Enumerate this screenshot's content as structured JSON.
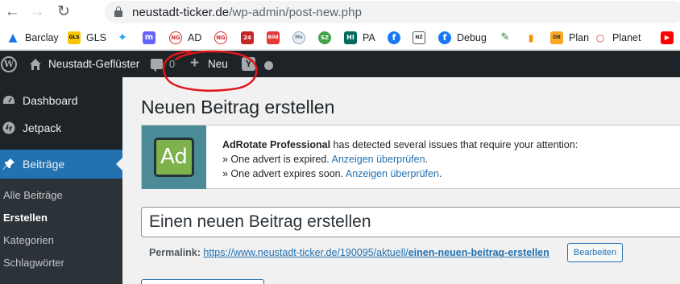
{
  "browser": {
    "url_host": "neustadt-ticker.de",
    "url_path": "/wp-admin/post-new.php",
    "back_icon": "arrow-left-icon",
    "forward_icon": "arrow-right-icon",
    "reload_icon": "reload-icon"
  },
  "bookmarks": [
    {
      "label": "Barclay",
      "icon": "eagle-icon",
      "color": "#1a73e8"
    },
    {
      "label": "GLS",
      "icon": "gls-icon",
      "color": "#f7c600"
    },
    {
      "label": "",
      "icon": "twitter-icon",
      "color": "#1da1f2"
    },
    {
      "label": "",
      "icon": "mastodon-icon",
      "color": "#6364ff"
    },
    {
      "label": "AD",
      "icon": "ng-icon",
      "color": "#d32f2f"
    },
    {
      "label": "",
      "icon": "ng-icon",
      "color": "#d32f2f"
    },
    {
      "label": "",
      "icon": "tv24-icon",
      "color": "#c62828"
    },
    {
      "label": "",
      "icon": "bild-icon",
      "color": "#e53935"
    },
    {
      "label": "",
      "icon": "news-icon",
      "color": "#90a4ae"
    },
    {
      "label": "",
      "icon": "sz-icon",
      "color": "#43a047"
    },
    {
      "label": "PA",
      "icon": "pa-icon",
      "color": "#00695c"
    },
    {
      "label": "",
      "icon": "facebook-icon",
      "color": "#1877f2"
    },
    {
      "label": "",
      "icon": "newspaper-icon",
      "color": "#555555"
    },
    {
      "label": "Debug",
      "icon": "facebook-icon",
      "color": "#1877f2"
    },
    {
      "label": "",
      "icon": "pencil-icon",
      "color": "#2e7d32"
    },
    {
      "label": "",
      "icon": "chart-icon",
      "color": "#fb8c00"
    },
    {
      "label": "Plan",
      "icon": "db-icon",
      "color": "#f9a825"
    },
    {
      "label": "Planet",
      "icon": "planet-icon",
      "color": "#e53935"
    },
    {
      "label": "",
      "icon": "youtube-icon",
      "color": "#ff0000"
    }
  ],
  "adminbar": {
    "site_name": "Neustadt-Geflüster",
    "comment_count": "0",
    "new_label": "Neu",
    "yoast_letter": "Y",
    "logo_letter": "W"
  },
  "sidebar": {
    "items": [
      {
        "label": "Dashboard"
      },
      {
        "label": "Jetpack"
      },
      {
        "label": "Beiträge"
      }
    ],
    "submenu": [
      {
        "label": "Alle Beiträge"
      },
      {
        "label": "Erstellen"
      },
      {
        "label": "Kategorien"
      },
      {
        "label": "Schlagwörter"
      }
    ]
  },
  "main": {
    "page_title": "Neuen Beitrag erstellen",
    "notice": {
      "logo_text": "Ad",
      "plugin_name": "AdRotate Professional",
      "message": " has detected several issues that require your attention:",
      "line1_text": "» One advert is expired. ",
      "line1_link": "Anzeigen überprüfen",
      "line2_text": "» One advert expires soon. ",
      "line2_link": "Anzeigen überprüfen",
      "dot": "."
    },
    "title_value": "Einen neuen Beitrag erstellen",
    "permalink": {
      "label": "Permalink:",
      "url_base": "https://www.neustadt-ticker.de/190095/aktuell/",
      "slug": "einen-neuen-beitrag-erstellen",
      "edit_label": "Bearbeiten"
    }
  },
  "colors": {
    "adminbar_bg": "#1d2327",
    "accent": "#2271b1",
    "annotation": "#e0161b"
  }
}
